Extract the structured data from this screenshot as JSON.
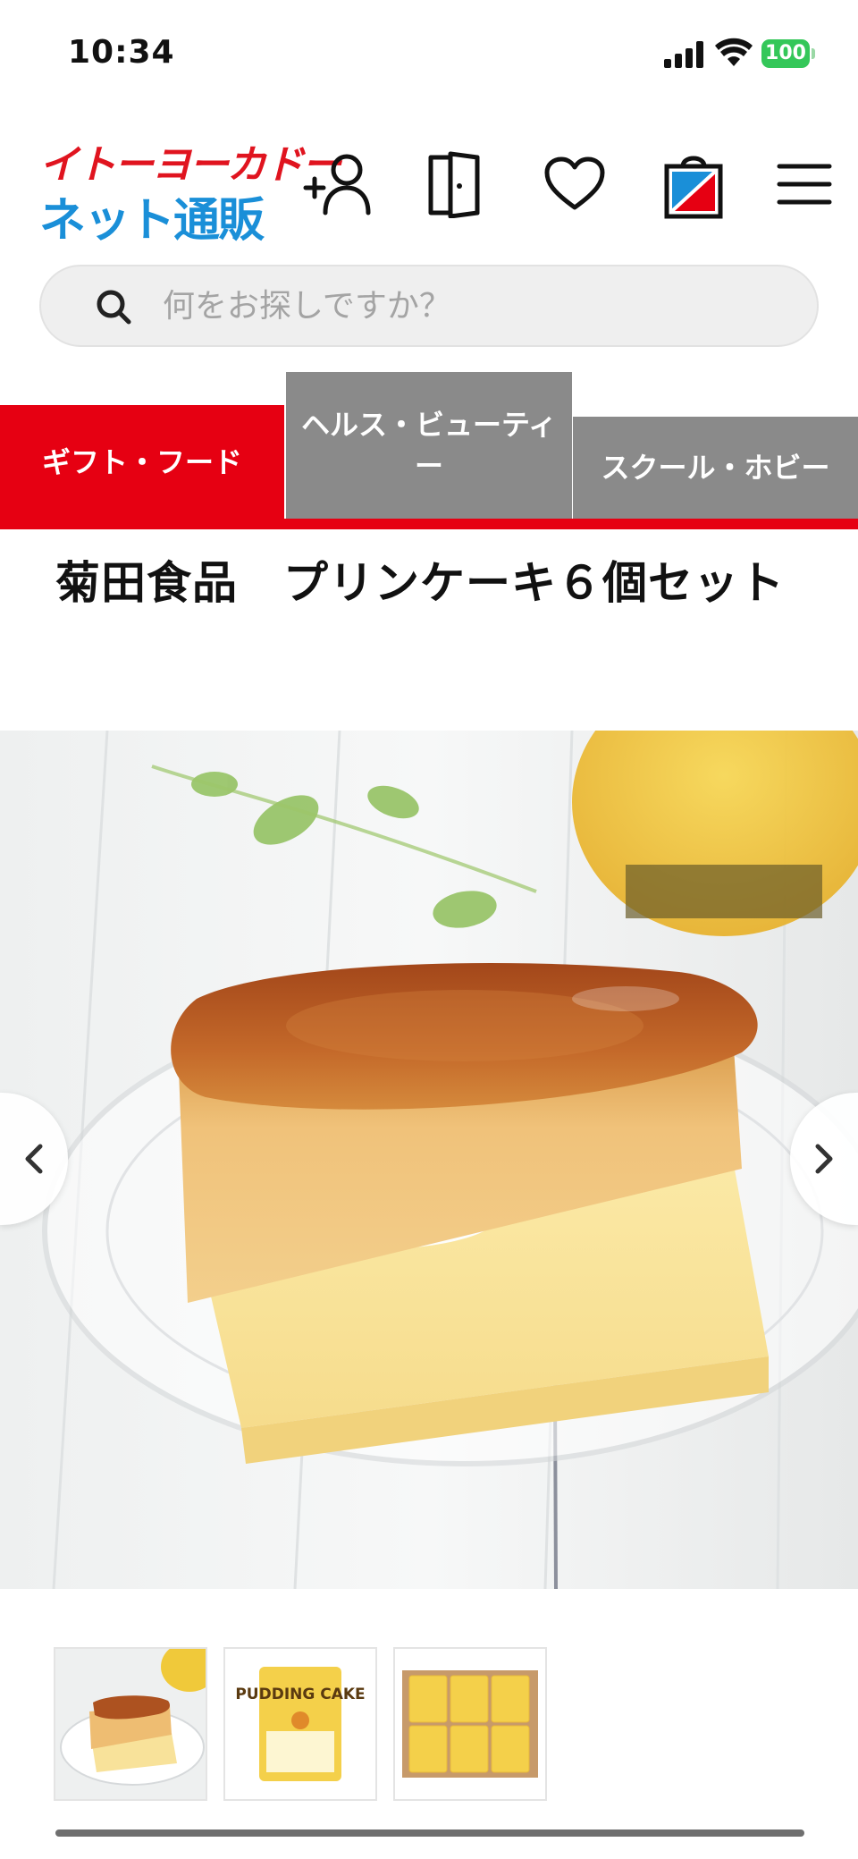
{
  "status_bar": {
    "time": "10:34",
    "battery": "100"
  },
  "header": {
    "logo_line1": "イトーヨーカドー",
    "logo_line2": "ネット通販",
    "icons": [
      "add-account-icon",
      "login-door-icon",
      "favorite-heart-icon",
      "shopping-bag-icon",
      "hamburger-menu-icon"
    ]
  },
  "search": {
    "placeholder": "何をお探しですか？",
    "value": ""
  },
  "categories": [
    {
      "label": "ギフト・フード",
      "active": true
    },
    {
      "label": "ヘルス・ビューティー",
      "active": false
    },
    {
      "label": "スクール・ホビー",
      "active": false
    }
  ],
  "product": {
    "title": "菊田食品　プリンケーキ６個セット"
  },
  "thumbnails": [
    {
      "name": "pudding-cake-on-plate"
    },
    {
      "name": "pudding-cake-package",
      "package_label": "PUDDING CAKE"
    },
    {
      "name": "pudding-cake-box-of-six"
    }
  ],
  "colors": {
    "brand_red": "#e60012",
    "brand_blue": "#1a8fd8",
    "tab_inactive": "#8a8a8a",
    "battery_green": "#34c759"
  }
}
